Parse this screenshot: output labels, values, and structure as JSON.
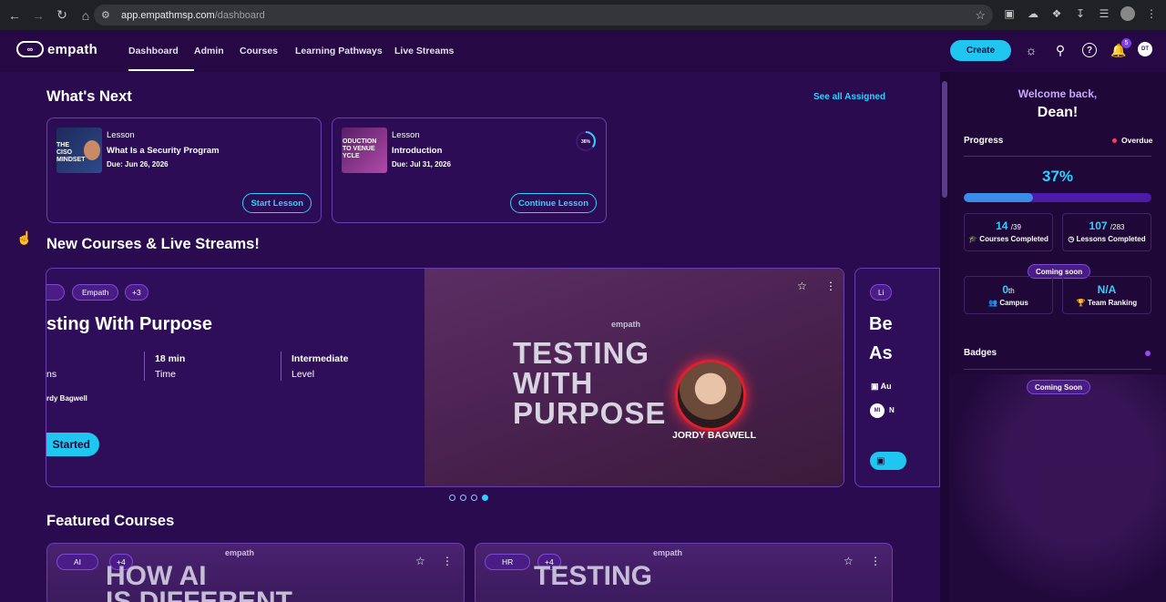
{
  "browser": {
    "url_domain": "app.empathmsp.com",
    "url_path": "/dashboard"
  },
  "header": {
    "brand": "empath",
    "nav": [
      "Dashboard",
      "Admin",
      "Courses",
      "Learning Pathways",
      "Live Streams"
    ],
    "active_nav": "Dashboard",
    "create_label": "Create",
    "notification_count": "5",
    "user_initials": "DT"
  },
  "whats_next": {
    "title": "What's Next",
    "see_all": "See all Assigned",
    "cards": [
      {
        "type": "Lesson",
        "title": "What Is a Security Program",
        "due": "Due: Jun 26, 2026",
        "button": "Start Lesson",
        "thumb_text": "THE CISO MINDSET"
      },
      {
        "type": "Lesson",
        "title": "Introduction",
        "due": "Due: Jul 31, 2026",
        "button": "Continue Lesson",
        "progress_label": "36%",
        "progress": 0.36,
        "thumb_text": "ODUCTION TO VENUE YCLE"
      }
    ]
  },
  "new_courses": {
    "title": "New Courses & Live Streams!",
    "featured": {
      "tags": [
        "Empath",
        "+3"
      ],
      "title": "sting With Purpose",
      "stats": [
        {
          "value": "",
          "label": "ns"
        },
        {
          "value": "18 min",
          "label": "Time"
        },
        {
          "value": "Intermediate",
          "label": "Level"
        }
      ],
      "author": "rdy Bagwell",
      "cta": "Started",
      "poster_brand": "empath",
      "poster_title": [
        "TESTING",
        "WITH",
        "PURPOSE"
      ],
      "poster_name": "JORDY BAGWELL"
    },
    "peek": {
      "tag": "Li",
      "title": [
        "Be",
        "As"
      ],
      "date": "Au",
      "initials": "MI",
      "initials_rest": "N"
    },
    "dots": 4,
    "active_dot": 3
  },
  "featured_courses": {
    "title": "Featured Courses",
    "cards": [
      {
        "tags": [
          "AI",
          "+4"
        ],
        "brand": "empath",
        "title": [
          "HOW AI",
          "IS DIFFERENT"
        ]
      },
      {
        "tags": [
          "HR",
          "+4"
        ],
        "brand": "empath",
        "title": [
          "TESTING"
        ]
      }
    ]
  },
  "sidebar": {
    "welcome": "Welcome back,",
    "name": "Dean!",
    "progress_label": "Progress",
    "overdue_label": "Overdue",
    "percent": "37%",
    "progress_value": 0.37,
    "courses": {
      "value": "14",
      "total": "/39",
      "label": "Courses Completed"
    },
    "lessons": {
      "value": "107",
      "total": "/283",
      "label": "Lessons Completed"
    },
    "coming_soon_1": "Coming soon",
    "campus": {
      "value": "0",
      "suffix": "th",
      "label": "Campus"
    },
    "ranking": {
      "value": "N/A",
      "label": "Team Ranking"
    },
    "badges_label": "Badges",
    "coming_soon_2": "Coming Soon"
  },
  "colors": {
    "accent": "#1fc6f0",
    "background": "#2b0b4f",
    "panel": "#1f0838",
    "overdue": "#ff3b5c"
  }
}
